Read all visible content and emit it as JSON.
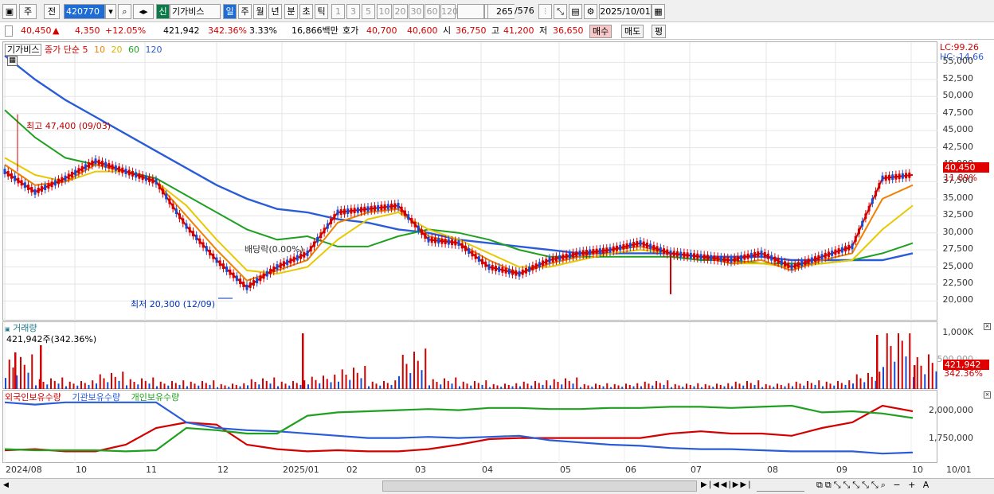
{
  "toolbar": {
    "period_label": "주",
    "prev_label": "전",
    "code_value": "420770",
    "shin_label": "신",
    "stock_name": "기가비스",
    "period_buttons": [
      "일",
      "주",
      "월",
      "년",
      "분",
      "초",
      "틱"
    ],
    "interval_buttons": [
      "1",
      "3",
      "5",
      "10",
      "20",
      "30",
      "60",
      "120"
    ],
    "count_value": "265",
    "count_total": "/576",
    "date_value": "2025/10/01"
  },
  "quote": {
    "price": "40,450",
    "arrow": "▲",
    "change": "4,350",
    "change_pct": "+12.05%",
    "volume": "421,942",
    "vol_ratio": "342.36%",
    "turnover_pct": "3.33%",
    "amount": "16,866백만",
    "ask_label": "호가",
    "ask": "40,700",
    "bid": "40,600",
    "open_label": "시",
    "open": "36,750",
    "high_label": "고",
    "high": "41,200",
    "low_label": "저",
    "low": "36,650",
    "buy_label": "매수",
    "sell_label": "매도",
    "eval_label": "평"
  },
  "price_panel": {
    "legend_name": "기가비스",
    "legend_type": "종가 단순",
    "ma_labels": [
      "5",
      "10",
      "20",
      "60",
      "120"
    ],
    "ma_colors": [
      "#d40000",
      "#f08000",
      "#e8c800",
      "#20a020",
      "#2a5cd8"
    ],
    "lc": "LC:99.26",
    "hc": "HC:-14.66",
    "ticks": [
      "55,000",
      "52,500",
      "50,000",
      "47,500",
      "45,000",
      "42,500",
      "40,000",
      "37,500",
      "35,000",
      "32,500",
      "30,000",
      "27,500",
      "25,000",
      "22,500",
      "20,000"
    ],
    "last_price": "40,450",
    "last_pct": "11.89%",
    "high_note": "최고 47,400 (09/03)",
    "low_note": "최저 20,300 (12/09)",
    "dividend_note": "배당락(0.00%)"
  },
  "volume_panel": {
    "title": "거래량",
    "value": "421,942주(342.36%)",
    "ticks": [
      "1,000K",
      "500,000"
    ],
    "last_volume": "421,942",
    "last_pct": "342.36%"
  },
  "holdings_panel": {
    "legend": [
      "외국인보유수량",
      "기관보유수량",
      "개인보유수량"
    ],
    "colors": [
      "#d40000",
      "#2a5cd8",
      "#20a020"
    ],
    "ticks": [
      "2,000,000",
      "1,750,000"
    ]
  },
  "x_axis": {
    "labels": [
      "2024/08",
      "10",
      "11",
      "12",
      "2025/01",
      "02",
      "03",
      "04",
      "05",
      "06",
      "07",
      "08",
      "09",
      "10"
    ],
    "right_label": "10/01"
  },
  "chart_data": {
    "type": "line",
    "title": "",
    "xlabel": "",
    "ylabel": "",
    "ylim": [
      19000,
      57500
    ],
    "months": [
      "2024/08",
      "10",
      "11",
      "12",
      "2025/01",
      "02",
      "03",
      "04",
      "05",
      "06",
      "07",
      "08",
      "09",
      "10"
    ],
    "series": [
      {
        "name": "5",
        "values": [
          39000,
          36000,
          38000,
          40500,
          39000,
          37500,
          31000,
          26000,
          22000,
          25000,
          27000,
          33000,
          33500,
          34000,
          29000,
          28500,
          25000,
          24000,
          26000,
          27000,
          27500,
          28500,
          27000,
          26500,
          26000,
          27000,
          25000,
          26500,
          28000,
          38000,
          38500
        ]
      },
      {
        "name": "10",
        "values": [
          40000,
          37000,
          37500,
          40000,
          39000,
          37500,
          32500,
          27500,
          23000,
          24500,
          26000,
          31500,
          33000,
          33500,
          29500,
          28500,
          26000,
          24000,
          25500,
          26500,
          27500,
          28000,
          27000,
          26500,
          25500,
          26000,
          24500,
          26000,
          27000,
          35000,
          37000
        ]
      },
      {
        "name": "20",
        "values": [
          41000,
          38500,
          37500,
          39000,
          39000,
          37500,
          34000,
          29000,
          24500,
          24000,
          25000,
          29000,
          32000,
          33000,
          30500,
          29000,
          27000,
          25000,
          25000,
          26000,
          27000,
          27500,
          27000,
          26500,
          25500,
          25500,
          25000,
          25500,
          26000,
          30500,
          34000
        ]
      },
      {
        "name": "60",
        "values": [
          48000,
          44000,
          41000,
          40000,
          39000,
          38000,
          35500,
          33000,
          30500,
          29000,
          29500,
          28000,
          28000,
          29500,
          30500,
          30000,
          29000,
          27500,
          26500,
          26500,
          26500,
          26500,
          26500,
          26000,
          26000,
          25500,
          25500,
          25500,
          26000,
          27000,
          28500
        ]
      },
      {
        "name": "120",
        "values": [
          56000,
          52500,
          49500,
          47000,
          44500,
          42000,
          39500,
          37000,
          35000,
          33500,
          33000,
          32000,
          31500,
          30500,
          30000,
          29000,
          28500,
          28000,
          27500,
          27000,
          27000,
          27000,
          27000,
          26500,
          26500,
          26500,
          26000,
          26000,
          26000,
          26000,
          27000
        ]
      }
    ],
    "volume_values": [
      120,
      40,
      30,
      60,
      40,
      30,
      30,
      20,
      40,
      30,
      50,
      80,
      30,
      140,
      40,
      30,
      20,
      30,
      40,
      20,
      20,
      30,
      20,
      20,
      30,
      20,
      30,
      30,
      60,
      240,
      130
    ],
    "holdings": [
      {
        "name": "외국인보유수량",
        "values": [
          1650000,
          1660000,
          1640000,
          1640000,
          1700000,
          1850000,
          1900000,
          1880000,
          1700000,
          1660000,
          1640000,
          1650000,
          1640000,
          1640000,
          1660000,
          1700000,
          1750000,
          1760000,
          1760000,
          1760000,
          1760000,
          1760000,
          1800000,
          1820000,
          1800000,
          1800000,
          1780000,
          1850000,
          1900000,
          2050000,
          2000000
        ]
      },
      {
        "name": "기관보유수량",
        "values": [
          2080000,
          2060000,
          2080000,
          2080000,
          2080000,
          2080000,
          1900000,
          1850000,
          1830000,
          1820000,
          1800000,
          1780000,
          1760000,
          1760000,
          1770000,
          1760000,
          1770000,
          1780000,
          1740000,
          1720000,
          1700000,
          1690000,
          1670000,
          1660000,
          1660000,
          1650000,
          1640000,
          1640000,
          1640000,
          1620000,
          1630000
        ]
      },
      {
        "name": "개인보유수량",
        "values": [
          1660000,
          1650000,
          1650000,
          1650000,
          1640000,
          1650000,
          1850000,
          1830000,
          1800000,
          1800000,
          1960000,
          1990000,
          2000000,
          2010000,
          2020000,
          2010000,
          2030000,
          2030000,
          2020000,
          2020000,
          2030000,
          2030000,
          2040000,
          2040000,
          2030000,
          2040000,
          2050000,
          1990000,
          2000000,
          1980000,
          1940000
        ]
      }
    ]
  }
}
